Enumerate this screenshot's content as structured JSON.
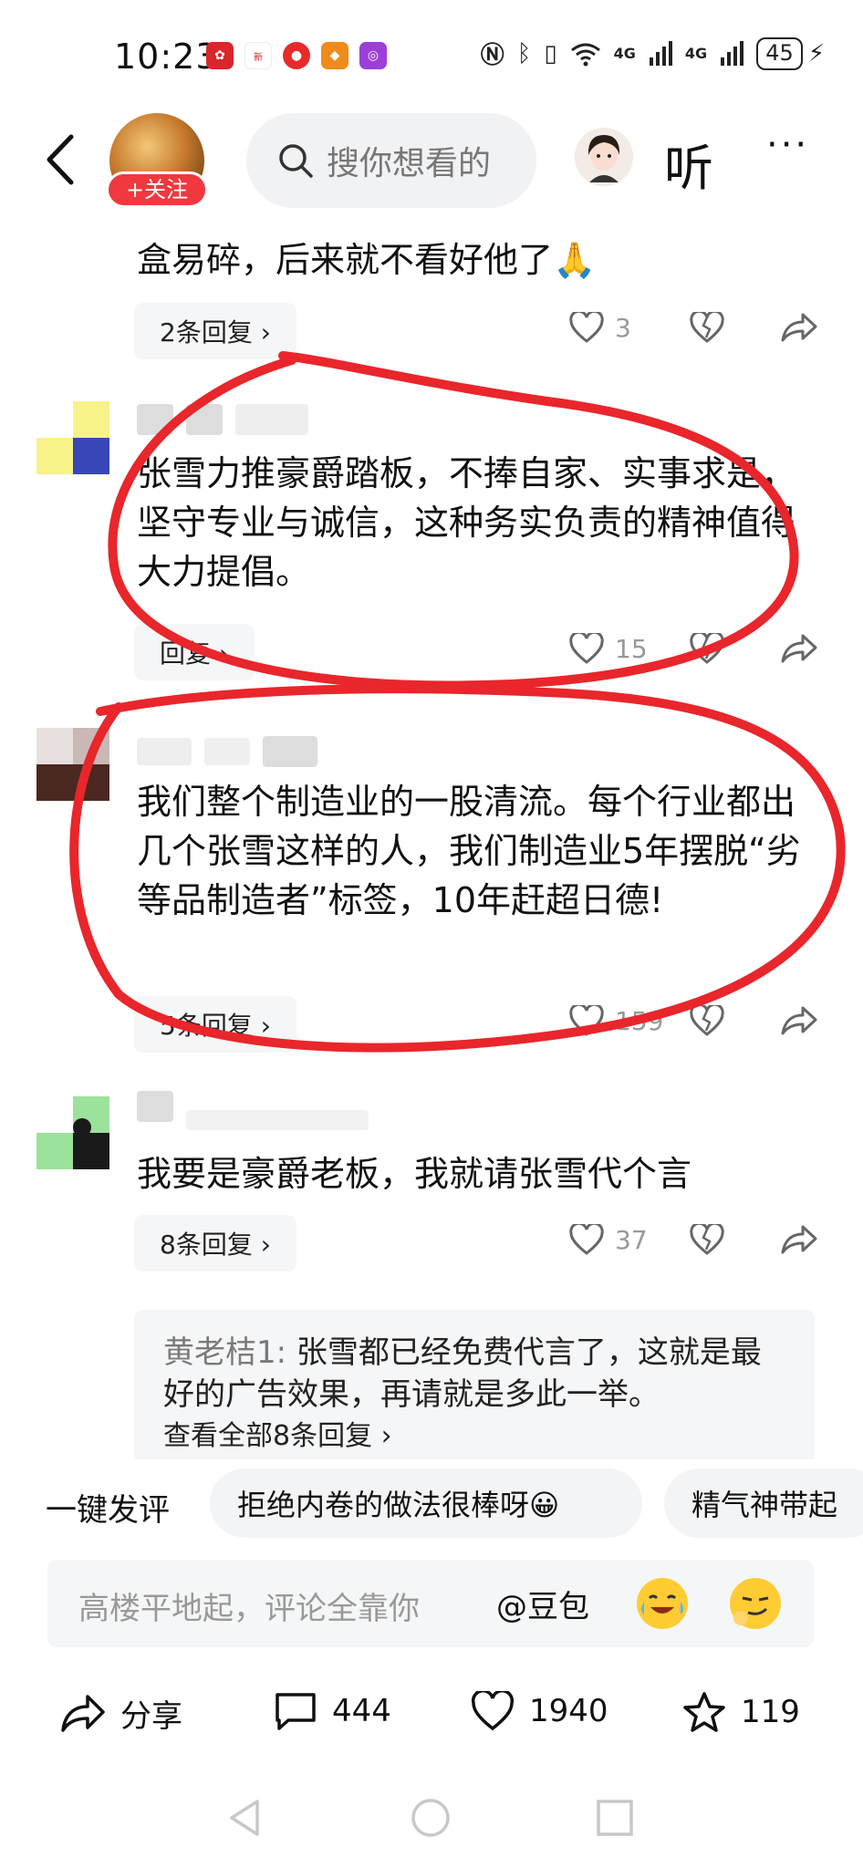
{
  "status": {
    "time": "10:23",
    "network_1": "4G",
    "network_2": "4G",
    "battery": "45"
  },
  "header": {
    "follow_label": "+关注",
    "search_placeholder": "搜你想看的",
    "listen_label": "听",
    "more_label": "···"
  },
  "comments": [
    {
      "text": "盒易碎，后来就不看好他了🙏",
      "reply_label": "2条回复 ›",
      "likes": "3"
    },
    {
      "text": "张雪力推豪爵踏板，不捧自家、实事求是，坚守专业与诚信，这种务实负责的精神值得大力提倡。",
      "reply_label": "回复 ›",
      "likes": "15"
    },
    {
      "text": "我们整个制造业的一股清流。每个行业都出几个张雪这样的人，我们制造业5年摆脱“劣等品制造者”标签，10年赶超日德!",
      "reply_label": "5条回复 ›",
      "likes": "159"
    },
    {
      "text": "我要是豪爵老板，我就请张雪代个言",
      "reply_label": "8条回复 ›",
      "likes": "37",
      "sub_reply": {
        "name": "黄老桔1:",
        "text": " 张雪都已经免费代言了，这就是最好的广告效果，再请就是多此一举。",
        "link": "查看全部8条回复 ›"
      }
    }
  ],
  "quick": {
    "label": "一键发评",
    "chips": [
      "拒绝内卷的做法很棒呀😀",
      "精气神带起"
    ]
  },
  "input": {
    "placeholder": "高楼平地起，评论全靠你",
    "mention": "@豆包"
  },
  "bottom": {
    "share_label": "分享",
    "comment_count": "444",
    "like_count": "1940",
    "fav_count": "119"
  },
  "colors": {
    "accent_red": "#f0383e",
    "annotation_red": "#e8262b"
  }
}
